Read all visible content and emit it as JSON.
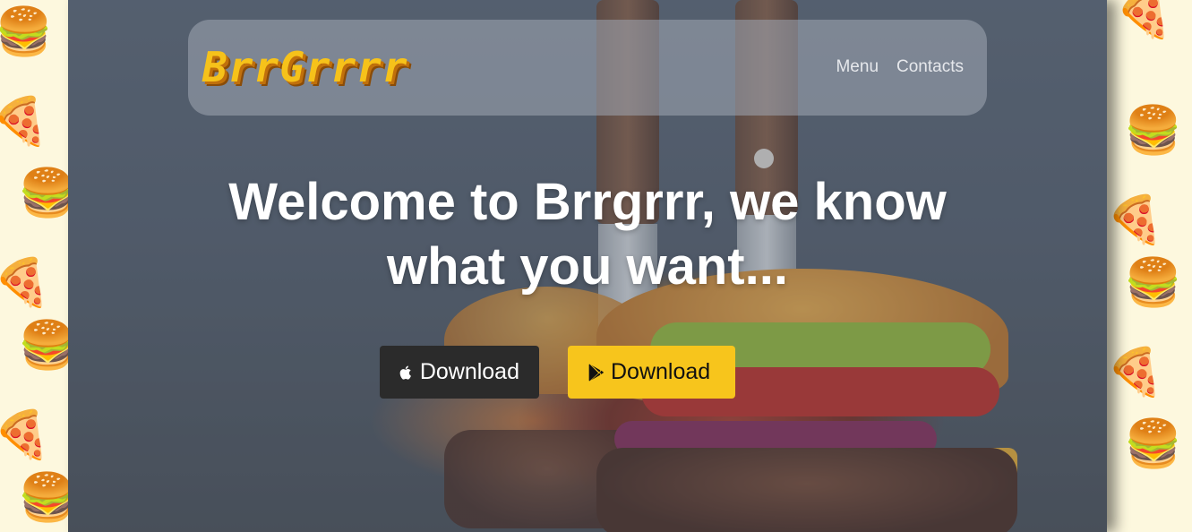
{
  "brand": {
    "logo_text": "BrrGrrrr"
  },
  "nav": {
    "items": [
      "Menu",
      "Contacts"
    ]
  },
  "hero": {
    "headline_line1": "Welcome to Brrgrrr, we know",
    "headline_line2": "what you want..."
  },
  "buttons": {
    "apple_label": "Download",
    "play_label": "Download"
  },
  "colors": {
    "accent": "#f7c51c",
    "dark_button": "#2b2b2b",
    "page_background": "#fdf8de"
  }
}
